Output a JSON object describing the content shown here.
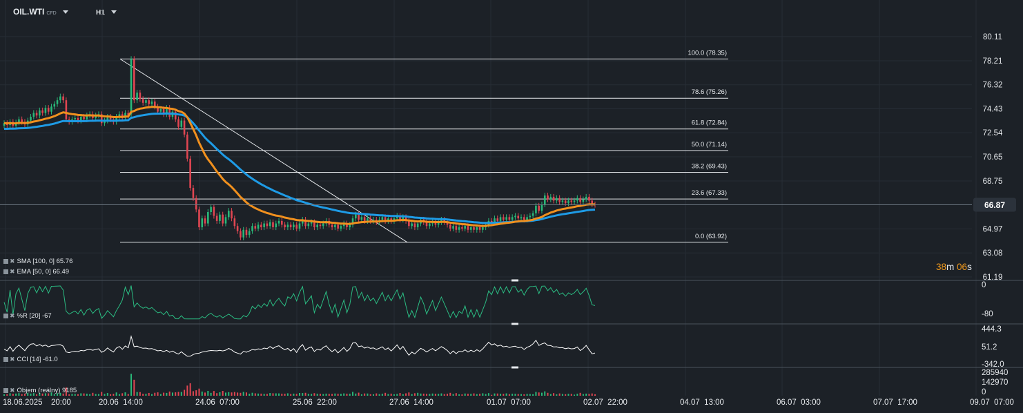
{
  "header": {
    "symbol": "OIL.WTI",
    "instrument_type": "CFD",
    "timeframe": "H1"
  },
  "timer": {
    "minutes": "38",
    "minutes_unit": "m",
    "seconds": "06",
    "seconds_unit": "s"
  },
  "indicators": {
    "sma": {
      "label": "SMA [100,  0]",
      "value": "65.76",
      "color": "#1e9be6"
    },
    "ema": {
      "label": "EMA [50,  0]",
      "value": "66.49",
      "color": "#f0901e"
    },
    "wpr": {
      "label": "%R [20]",
      "value": "-67"
    },
    "cci": {
      "label": "CCI [14]",
      "value": "-61.0"
    },
    "volume": {
      "label": "Objem  (reálny)",
      "value": "9185"
    }
  },
  "colors": {
    "background": "#1c2127",
    "up_candle": "#29b879",
    "down_candle": "#e04652",
    "sma": "#1e9be6",
    "ema": "#f0901e",
    "wpr_line": "#2bbd83",
    "cci_line": "#ffffff",
    "current_price": "#2b323b"
  },
  "price_axis": {
    "ticks": [
      80.11,
      78.21,
      76.32,
      74.43,
      72.54,
      70.65,
      68.75,
      66.87,
      64.97,
      63.08,
      61.19
    ],
    "current_price": "66.87"
  },
  "wpr_axis": {
    "ticks": [
      "0",
      "-80"
    ]
  },
  "cci_axis": {
    "ticks": [
      "444.3",
      "51.2",
      "-342.0"
    ]
  },
  "volume_axis": {
    "ticks": [
      "285940",
      "142970",
      "0"
    ]
  },
  "time_axis": {
    "labels": [
      "18.06.2025",
      "20:00",
      "20.06  14:00",
      "24.06  07:00",
      "25.06  22:00",
      "27.06  14:00",
      "01.07  07:00",
      "02.07  22:00",
      "04.07  13:00",
      "06.07  03:00",
      "07.07  17:00",
      "09.07  07:00"
    ]
  },
  "fibonacci": {
    "high": 78.35,
    "low": 63.92,
    "levels": [
      {
        "label": "100.0 (78.35)",
        "price": 78.35
      },
      {
        "label": "78.6 (75.26)",
        "price": 75.26
      },
      {
        "label": "61.8 (72.84)",
        "price": 72.84
      },
      {
        "label": "50.0 (71.14)",
        "price": 71.14
      },
      {
        "label": "38.2 (69.43)",
        "price": 69.43
      },
      {
        "label": "23.6 (67.33)",
        "price": 67.33
      },
      {
        "label": "0.0 (63.92)",
        "price": 63.92
      }
    ]
  },
  "chart_data": {
    "type": "candlestick",
    "instrument": "OIL.WTI",
    "timeframe": "H1",
    "ylim": [
      61.19,
      81.0
    ],
    "grid": true,
    "bars": [
      {
        "o": 73.1,
        "c": 73.3
      },
      {
        "o": 73.3,
        "c": 73.15
      },
      {
        "o": 73.15,
        "c": 73.4
      },
      {
        "o": 73.4,
        "c": 73.1
      },
      {
        "o": 73.1,
        "c": 73.35
      },
      {
        "o": 73.35,
        "c": 73.6
      },
      {
        "o": 73.6,
        "c": 73.4
      },
      {
        "o": 73.4,
        "c": 73.2
      },
      {
        "o": 73.2,
        "c": 73.5
      },
      {
        "o": 73.5,
        "c": 73.8
      },
      {
        "o": 73.8,
        "c": 74.1
      },
      {
        "o": 74.1,
        "c": 73.9
      },
      {
        "o": 73.9,
        "c": 74.3
      },
      {
        "o": 74.3,
        "c": 74.1
      },
      {
        "o": 74.1,
        "c": 74.5
      },
      {
        "o": 74.5,
        "c": 74.2
      },
      {
        "o": 74.2,
        "c": 74.6
      },
      {
        "o": 74.6,
        "c": 74.8
      },
      {
        "o": 74.8,
        "c": 75.1
      },
      {
        "o": 75.1,
        "c": 75.4
      },
      {
        "o": 75.4,
        "c": 75.1
      },
      {
        "o": 75.1,
        "c": 73.6
      },
      {
        "o": 73.6,
        "c": 73.4
      },
      {
        "o": 73.4,
        "c": 73.6
      },
      {
        "o": 73.6,
        "c": 73.7
      },
      {
        "o": 73.7,
        "c": 73.5
      },
      {
        "o": 73.5,
        "c": 73.8
      },
      {
        "o": 73.8,
        "c": 73.6
      },
      {
        "o": 73.6,
        "c": 73.9
      },
      {
        "o": 73.9,
        "c": 74.0
      },
      {
        "o": 74.0,
        "c": 73.7
      },
      {
        "o": 73.7,
        "c": 73.9
      },
      {
        "o": 73.9,
        "c": 74.0
      },
      {
        "o": 74.0,
        "c": 73.3
      },
      {
        "o": 73.3,
        "c": 73.5
      },
      {
        "o": 73.5,
        "c": 73.8
      },
      {
        "o": 73.8,
        "c": 73.6
      },
      {
        "o": 73.6,
        "c": 73.4
      },
      {
        "o": 73.4,
        "c": 73.8
      },
      {
        "o": 73.8,
        "c": 74.0
      },
      {
        "o": 74.0,
        "c": 73.7
      },
      {
        "o": 73.7,
        "c": 74.1
      },
      {
        "o": 74.1,
        "c": 73.9
      },
      {
        "o": 74.0,
        "c": 78.35
      },
      {
        "o": 78.35,
        "c": 75.1
      },
      {
        "o": 75.1,
        "c": 75.7
      },
      {
        "o": 75.7,
        "c": 75.2
      },
      {
        "o": 75.2,
        "c": 74.9
      },
      {
        "o": 74.9,
        "c": 75.1
      },
      {
        "o": 75.1,
        "c": 74.8
      },
      {
        "o": 74.8,
        "c": 75.0
      },
      {
        "o": 75.0,
        "c": 74.6
      },
      {
        "o": 74.6,
        "c": 74.2
      },
      {
        "o": 74.2,
        "c": 74.4
      },
      {
        "o": 74.4,
        "c": 74.0
      },
      {
        "o": 74.0,
        "c": 74.5
      },
      {
        "o": 74.5,
        "c": 73.8
      },
      {
        "o": 73.8,
        "c": 74.2
      },
      {
        "o": 74.2,
        "c": 73.6
      },
      {
        "o": 73.6,
        "c": 73.0
      },
      {
        "o": 73.0,
        "c": 73.5
      },
      {
        "o": 73.5,
        "c": 72.4
      },
      {
        "o": 72.4,
        "c": 70.5
      },
      {
        "o": 70.5,
        "c": 68.2
      },
      {
        "o": 68.2,
        "c": 67.4
      },
      {
        "o": 67.4,
        "c": 66.5
      },
      {
        "o": 66.5,
        "c": 65.1
      },
      {
        "o": 65.1,
        "c": 65.8
      },
      {
        "o": 65.8,
        "c": 65.4
      },
      {
        "o": 65.4,
        "c": 66.3
      },
      {
        "o": 66.3,
        "c": 66.7
      },
      {
        "o": 66.7,
        "c": 66.0
      },
      {
        "o": 66.0,
        "c": 65.6
      },
      {
        "o": 65.6,
        "c": 66.1
      },
      {
        "o": 66.1,
        "c": 65.4
      },
      {
        "o": 65.4,
        "c": 65.9
      },
      {
        "o": 65.9,
        "c": 66.4
      },
      {
        "o": 66.4,
        "c": 65.8
      },
      {
        "o": 65.8,
        "c": 65.2
      },
      {
        "o": 65.2,
        "c": 64.8
      },
      {
        "o": 64.8,
        "c": 64.3
      },
      {
        "o": 64.3,
        "c": 64.9
      },
      {
        "o": 64.9,
        "c": 64.5
      },
      {
        "o": 64.5,
        "c": 64.8
      },
      {
        "o": 64.8,
        "c": 65.2
      },
      {
        "o": 65.2,
        "c": 65.0
      },
      {
        "o": 65.0,
        "c": 65.3
      },
      {
        "o": 65.3,
        "c": 65.1
      },
      {
        "o": 65.1,
        "c": 65.4
      },
      {
        "o": 65.4,
        "c": 65.2
      },
      {
        "o": 65.2,
        "c": 65.5
      },
      {
        "o": 65.5,
        "c": 65.1
      },
      {
        "o": 65.1,
        "c": 65.4
      },
      {
        "o": 65.4,
        "c": 65.6
      },
      {
        "o": 65.6,
        "c": 65.3
      },
      {
        "o": 65.3,
        "c": 65.1
      },
      {
        "o": 65.1,
        "c": 65.3
      },
      {
        "o": 65.3,
        "c": 65.1
      },
      {
        "o": 65.1,
        "c": 65.3
      },
      {
        "o": 65.3,
        "c": 65.0
      },
      {
        "o": 65.0,
        "c": 65.4
      },
      {
        "o": 65.4,
        "c": 65.7
      },
      {
        "o": 65.7,
        "c": 65.2
      },
      {
        "o": 65.2,
        "c": 65.4
      },
      {
        "o": 65.4,
        "c": 65.5
      },
      {
        "o": 65.5,
        "c": 65.1
      },
      {
        "o": 65.1,
        "c": 65.3
      },
      {
        "o": 65.3,
        "c": 65.2
      },
      {
        "o": 65.2,
        "c": 65.4
      },
      {
        "o": 65.4,
        "c": 65.6
      },
      {
        "o": 65.6,
        "c": 65.3
      },
      {
        "o": 65.3,
        "c": 65.1
      },
      {
        "o": 65.1,
        "c": 65.3
      },
      {
        "o": 65.3,
        "c": 65.0
      },
      {
        "o": 65.0,
        "c": 65.2
      },
      {
        "o": 65.2,
        "c": 65.4
      },
      {
        "o": 65.4,
        "c": 65.1
      },
      {
        "o": 65.1,
        "c": 65.3
      },
      {
        "o": 65.3,
        "c": 65.8
      },
      {
        "o": 65.8,
        "c": 66.1
      },
      {
        "o": 66.1,
        "c": 65.7
      },
      {
        "o": 65.7,
        "c": 65.9
      },
      {
        "o": 65.9,
        "c": 65.6
      },
      {
        "o": 65.6,
        "c": 65.8
      },
      {
        "o": 65.8,
        "c": 65.6
      },
      {
        "o": 65.6,
        "c": 65.7
      },
      {
        "o": 65.7,
        "c": 65.5
      },
      {
        "o": 65.5,
        "c": 65.7
      },
      {
        "o": 65.7,
        "c": 65.9
      },
      {
        "o": 65.9,
        "c": 65.6
      },
      {
        "o": 65.6,
        "c": 65.8
      },
      {
        "o": 65.8,
        "c": 65.6
      },
      {
        "o": 65.6,
        "c": 65.8
      },
      {
        "o": 65.8,
        "c": 66.0
      },
      {
        "o": 66.0,
        "c": 65.7
      },
      {
        "o": 65.7,
        "c": 65.9
      },
      {
        "o": 65.9,
        "c": 65.6
      },
      {
        "o": 65.6,
        "c": 65.2
      },
      {
        "o": 65.2,
        "c": 65.4
      },
      {
        "o": 65.4,
        "c": 65.1
      },
      {
        "o": 65.1,
        "c": 65.4
      },
      {
        "o": 65.4,
        "c": 65.7
      },
      {
        "o": 65.7,
        "c": 65.5
      },
      {
        "o": 65.5,
        "c": 65.2
      },
      {
        "o": 65.2,
        "c": 65.4
      },
      {
        "o": 65.4,
        "c": 65.6
      },
      {
        "o": 65.6,
        "c": 65.3
      },
      {
        "o": 65.3,
        "c": 65.5
      },
      {
        "o": 65.5,
        "c": 65.7
      },
      {
        "o": 65.7,
        "c": 65.5
      },
      {
        "o": 65.5,
        "c": 65.3
      },
      {
        "o": 65.3,
        "c": 65.0
      },
      {
        "o": 65.0,
        "c": 65.2
      },
      {
        "o": 65.2,
        "c": 64.9
      },
      {
        "o": 64.9,
        "c": 65.1
      },
      {
        "o": 65.1,
        "c": 65.0
      },
      {
        "o": 65.0,
        "c": 65.2
      },
      {
        "o": 65.2,
        "c": 64.9
      },
      {
        "o": 64.9,
        "c": 65.1
      },
      {
        "o": 65.1,
        "c": 64.9
      },
      {
        "o": 64.9,
        "c": 65.1
      },
      {
        "o": 65.1,
        "c": 64.9
      },
      {
        "o": 64.9,
        "c": 65.1
      },
      {
        "o": 65.1,
        "c": 65.3
      },
      {
        "o": 65.3,
        "c": 65.6
      },
      {
        "o": 65.6,
        "c": 65.5
      },
      {
        "o": 65.5,
        "c": 65.8
      },
      {
        "o": 65.8,
        "c": 65.6
      },
      {
        "o": 65.6,
        "c": 65.9
      },
      {
        "o": 65.9,
        "c": 65.7
      },
      {
        "o": 65.7,
        "c": 65.9
      },
      {
        "o": 65.9,
        "c": 65.7
      },
      {
        "o": 65.7,
        "c": 65.9
      },
      {
        "o": 65.9,
        "c": 66.0
      },
      {
        "o": 66.0,
        "c": 65.8
      },
      {
        "o": 65.8,
        "c": 65.9
      },
      {
        "o": 65.9,
        "c": 65.7
      },
      {
        "o": 65.7,
        "c": 65.9
      },
      {
        "o": 65.9,
        "c": 66.0
      },
      {
        "o": 66.0,
        "c": 66.2
      },
      {
        "o": 66.2,
        "c": 66.8
      },
      {
        "o": 66.8,
        "c": 66.4
      },
      {
        "o": 66.4,
        "c": 66.9
      },
      {
        "o": 66.9,
        "c": 67.6
      },
      {
        "o": 67.6,
        "c": 67.3
      },
      {
        "o": 67.3,
        "c": 67.5
      },
      {
        "o": 67.5,
        "c": 67.2
      },
      {
        "o": 67.2,
        "c": 67.4
      },
      {
        "o": 67.4,
        "c": 67.1
      },
      {
        "o": 67.1,
        "c": 67.2
      },
      {
        "o": 67.2,
        "c": 67.0
      },
      {
        "o": 67.0,
        "c": 67.2
      },
      {
        "o": 67.2,
        "c": 67.1
      },
      {
        "o": 67.1,
        "c": 67.2
      },
      {
        "o": 67.2,
        "c": 67.4
      },
      {
        "o": 67.4,
        "c": 67.1
      },
      {
        "o": 67.1,
        "c": 67.3
      },
      {
        "o": 67.3,
        "c": 67.5
      },
      {
        "o": 67.5,
        "c": 67.2
      },
      {
        "o": 67.2,
        "c": 66.9
      },
      {
        "o": 66.9,
        "c": 66.87
      }
    ]
  }
}
